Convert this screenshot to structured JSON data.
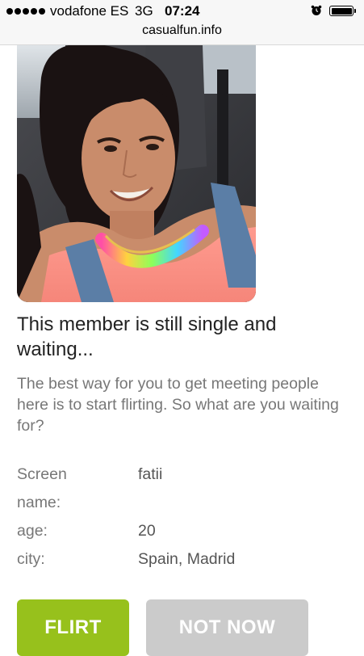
{
  "status_bar": {
    "carrier": "vodafone ES",
    "network": "3G",
    "time": "07:24",
    "icons": [
      "signal-dots-icon",
      "alarm-clock-icon",
      "battery-icon"
    ],
    "battery_level": 1.0
  },
  "browser": {
    "url": "casualfun.info"
  },
  "profile": {
    "photo": "member-photo",
    "headline": "This member is still single and waiting...",
    "subtext": "The best way for you to get meeting people here is to start flirting. So what are you waiting for?",
    "fields": [
      {
        "label": "Screen name:",
        "value": "fatii"
      },
      {
        "label": "age:",
        "value": "20"
      },
      {
        "label": "city:",
        "value": "Spain, Madrid"
      }
    ]
  },
  "actions": {
    "flirt_label": "FLIRT",
    "not_now_label": "NOT NOW"
  },
  "colors": {
    "flirt_button": "#97c11c",
    "not_now_button": "#cbcbcb",
    "headline_text": "#222222",
    "body_text": "#777777"
  }
}
